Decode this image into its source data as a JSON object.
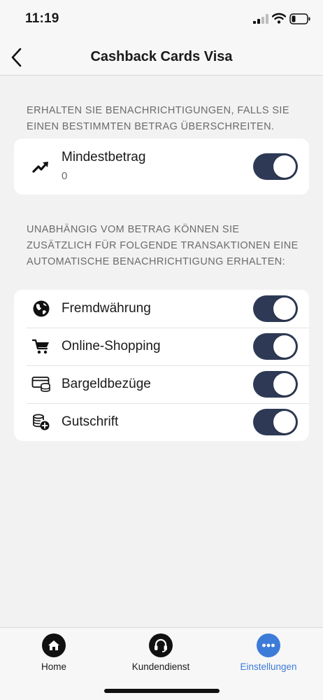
{
  "status_bar": {
    "time": "11:19"
  },
  "header": {
    "title": "Cashback Cards Visa"
  },
  "section_amount": {
    "header": "ERHALTEN SIE BENACHRICHTIGUNGEN, FALLS SIE EINEN BESTIMMTEN BETRAG ÜBERSCHREITEN.",
    "item": {
      "label": "Mindestbetrag",
      "value": "0",
      "icon": "trend-up-icon",
      "enabled": true
    }
  },
  "section_transactions": {
    "header": "UNABHÄNGIG VOM BETRAG KÖNNEN SIE ZUSÄTZLICH FÜR FOLGENDE TRANSAKTIONEN EINE AUTOMATISCHE BENACHRICHTIGUNG ERHALTEN:",
    "items": [
      {
        "label": "Fremdwährung",
        "icon": "globe-icon",
        "enabled": true
      },
      {
        "label": "Online-Shopping",
        "icon": "shopping-cart-icon",
        "enabled": true
      },
      {
        "label": "Bargeldbezüge",
        "icon": "cash-icon",
        "enabled": true
      },
      {
        "label": "Gutschrift",
        "icon": "coins-plus-icon",
        "enabled": true
      }
    ]
  },
  "tab_bar": {
    "tabs": [
      {
        "label": "Home",
        "icon": "home-icon"
      },
      {
        "label": "Kundendienst",
        "icon": "headset-icon"
      },
      {
        "label": "Einstellungen",
        "icon": "more-icon",
        "active": true
      }
    ]
  },
  "colors": {
    "toggle_on": "#2e3a55",
    "accent": "#3d7bd9",
    "background": "#f2f2f2"
  }
}
